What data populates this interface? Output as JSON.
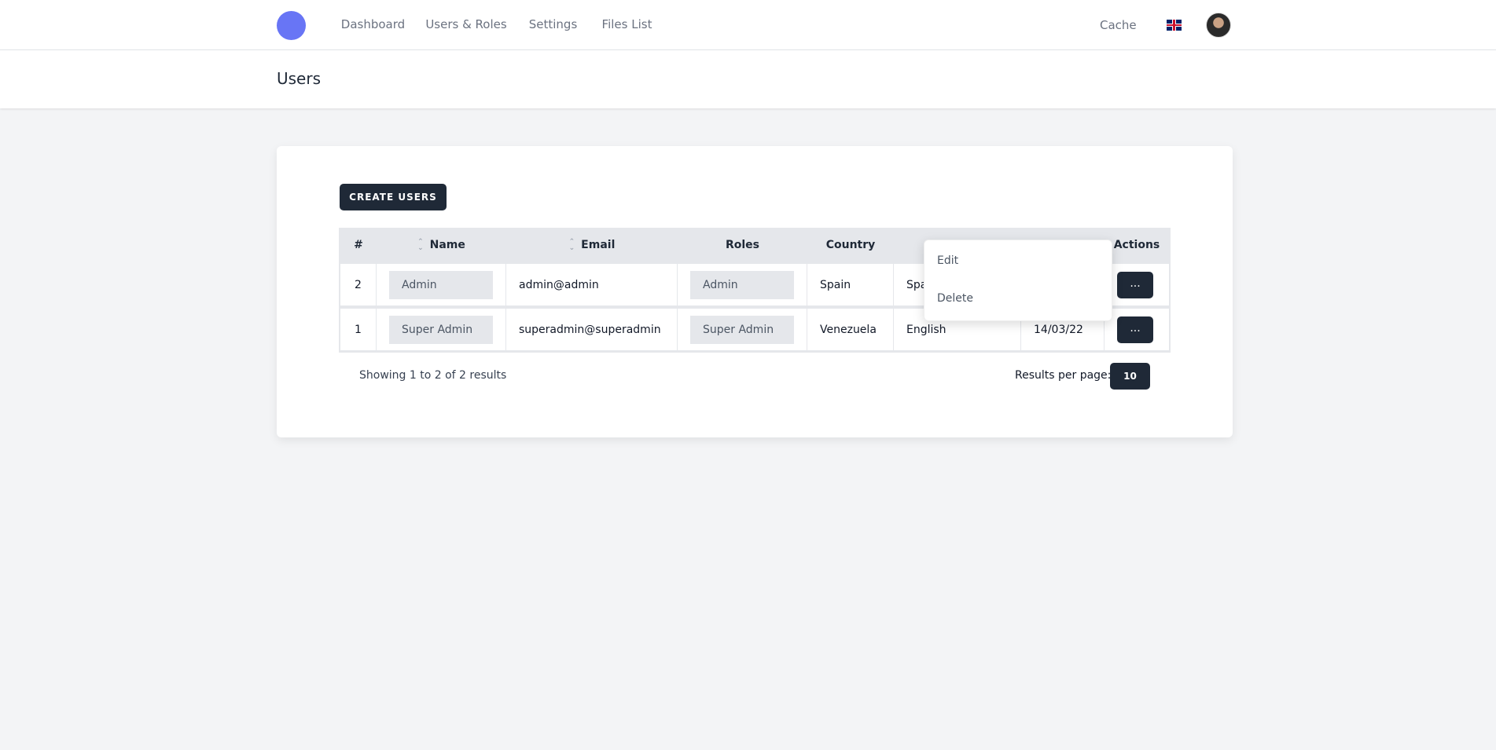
{
  "nav": {
    "items": [
      {
        "label": "Dashboard"
      },
      {
        "label": "Users & Roles"
      },
      {
        "label": "Settings"
      },
      {
        "label": "Files List"
      }
    ],
    "cache": "Cache",
    "language_icon": "uk-flag-icon",
    "accent": "#6875f5"
  },
  "header": {
    "title": "Users"
  },
  "main": {
    "create_label": "CREATE USERS",
    "columns": [
      "#",
      "Name",
      "Email",
      "Roles",
      "Country",
      "",
      "",
      "Actions"
    ],
    "rows": [
      {
        "id": "2",
        "name": "Admin",
        "email": "admin@admin",
        "role": "Admin",
        "country": "Spain",
        "language": "Spa",
        "date": "",
        "action": "..."
      },
      {
        "id": "1",
        "name": "Super Admin",
        "email": "superadmin@superadmin",
        "role": "Super Admin",
        "country": "Venezuela",
        "language": "English",
        "date": "14/03/22",
        "action": "..."
      }
    ],
    "dropdown": {
      "edit": "Edit",
      "delete": "Delete"
    },
    "showing": "Showing 1 to 2 of 2 results",
    "results_per_page_label": "Results per page:",
    "results_per_page": "10"
  }
}
